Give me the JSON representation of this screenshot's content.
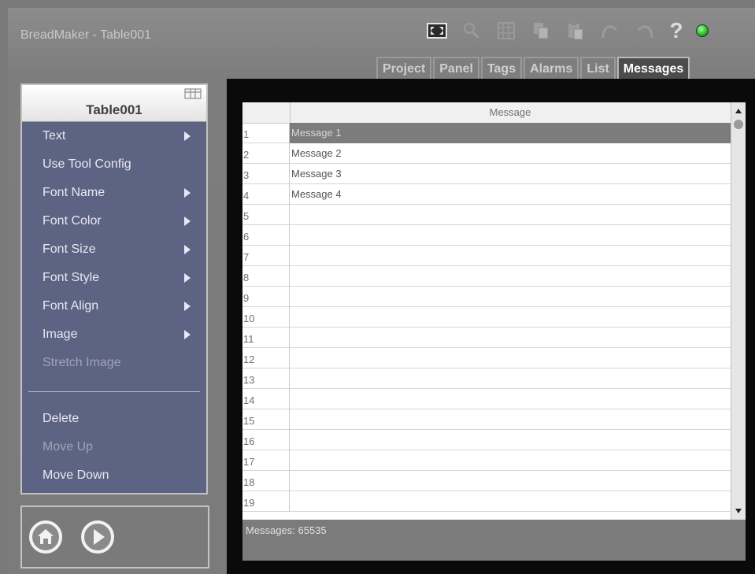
{
  "window": {
    "title": "BreadMaker - Table001"
  },
  "toolbar": {
    "icons": [
      "fullscreen-icon",
      "zoom-icon",
      "grid-icon",
      "copy-icon",
      "paste-icon",
      "undo-icon",
      "redo-icon",
      "help-icon",
      "status-led-icon"
    ],
    "help_label": "?",
    "led_color": "#1fb81f"
  },
  "tabs": [
    {
      "label": "Project",
      "active": false
    },
    {
      "label": "Panel",
      "active": false
    },
    {
      "label": "Tags",
      "active": false
    },
    {
      "label": "Alarms",
      "active": false
    },
    {
      "label": "List",
      "active": false
    },
    {
      "label": "Messages",
      "active": true
    }
  ],
  "menu": {
    "title": "Table001",
    "items": [
      {
        "label": "Text",
        "submenu": true,
        "enabled": true
      },
      {
        "label": "Use Tool Config",
        "submenu": false,
        "enabled": true
      },
      {
        "label": "Font Name",
        "submenu": true,
        "enabled": true
      },
      {
        "label": "Font Color",
        "submenu": true,
        "enabled": true
      },
      {
        "label": "Font Size",
        "submenu": true,
        "enabled": true
      },
      {
        "label": "Font Style",
        "submenu": true,
        "enabled": true
      },
      {
        "label": "Font Align",
        "submenu": true,
        "enabled": true
      },
      {
        "label": "Image",
        "submenu": true,
        "enabled": true
      },
      {
        "label": "Stretch Image",
        "submenu": false,
        "enabled": false
      }
    ],
    "actions": [
      {
        "label": "Delete",
        "enabled": true
      },
      {
        "label": "Move Up",
        "enabled": false
      },
      {
        "label": "Move Down",
        "enabled": true
      }
    ]
  },
  "nav": {
    "home_icon": "home-icon",
    "play_icon": "play-icon"
  },
  "table": {
    "column_header": "Message",
    "rows": [
      {
        "num": "1",
        "msg": "Message 1",
        "selected": true
      },
      {
        "num": "2",
        "msg": "Message 2",
        "selected": false
      },
      {
        "num": "3",
        "msg": "Message 3",
        "selected": false
      },
      {
        "num": "4",
        "msg": "Message 4",
        "selected": false
      },
      {
        "num": "5",
        "msg": "",
        "selected": false
      },
      {
        "num": "6",
        "msg": "",
        "selected": false
      },
      {
        "num": "7",
        "msg": "",
        "selected": false
      },
      {
        "num": "8",
        "msg": "",
        "selected": false
      },
      {
        "num": "9",
        "msg": "",
        "selected": false
      },
      {
        "num": "10",
        "msg": "",
        "selected": false
      },
      {
        "num": "11",
        "msg": "",
        "selected": false
      },
      {
        "num": "12",
        "msg": "",
        "selected": false
      },
      {
        "num": "13",
        "msg": "",
        "selected": false
      },
      {
        "num": "14",
        "msg": "",
        "selected": false
      },
      {
        "num": "15",
        "msg": "",
        "selected": false
      },
      {
        "num": "16",
        "msg": "",
        "selected": false
      },
      {
        "num": "17",
        "msg": "",
        "selected": false
      },
      {
        "num": "18",
        "msg": "",
        "selected": false
      },
      {
        "num": "19",
        "msg": "",
        "selected": false
      }
    ]
  },
  "status": {
    "text": "Messages: 65535"
  }
}
